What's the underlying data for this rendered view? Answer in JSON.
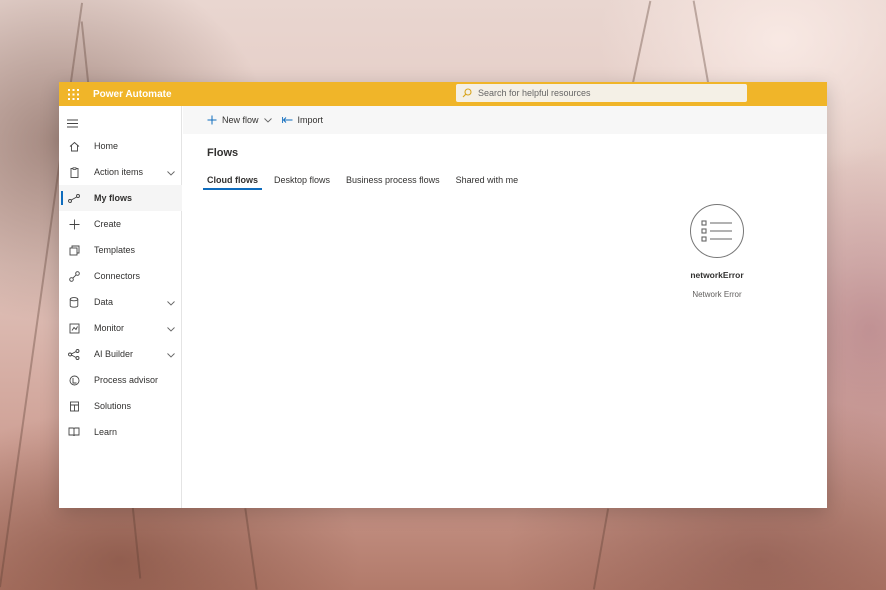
{
  "app": {
    "title": "Power Automate"
  },
  "search": {
    "placeholder": "Search for helpful resources"
  },
  "sidebar": {
    "items": [
      {
        "label": "Home",
        "icon": "home-icon",
        "has_chevron": false,
        "active": false
      },
      {
        "label": "Action items",
        "icon": "clipboard-icon",
        "has_chevron": true,
        "active": false
      },
      {
        "label": "My flows",
        "icon": "flow-icon",
        "has_chevron": false,
        "active": true
      },
      {
        "label": "Create",
        "icon": "plus-icon",
        "has_chevron": false,
        "active": false
      },
      {
        "label": "Templates",
        "icon": "templates-icon",
        "has_chevron": false,
        "active": false
      },
      {
        "label": "Connectors",
        "icon": "connector-icon",
        "has_chevron": false,
        "active": false
      },
      {
        "label": "Data",
        "icon": "database-icon",
        "has_chevron": true,
        "active": false
      },
      {
        "label": "Monitor",
        "icon": "monitor-icon",
        "has_chevron": true,
        "active": false
      },
      {
        "label": "AI Builder",
        "icon": "ai-builder-icon",
        "has_chevron": true,
        "active": false
      },
      {
        "label": "Process advisor",
        "icon": "process-advisor-icon",
        "has_chevron": false,
        "active": false
      },
      {
        "label": "Solutions",
        "icon": "solutions-icon",
        "has_chevron": false,
        "active": false
      },
      {
        "label": "Learn",
        "icon": "book-icon",
        "has_chevron": false,
        "active": false
      }
    ]
  },
  "commandbar": {
    "new_flow_label": "New flow",
    "import_label": "Import"
  },
  "main": {
    "title": "Flows",
    "tabs": [
      {
        "label": "Cloud flows",
        "active": true
      },
      {
        "label": "Desktop flows",
        "active": false
      },
      {
        "label": "Business process flows",
        "active": false
      },
      {
        "label": "Shared with me",
        "active": false
      }
    ],
    "error": {
      "title": "networkError",
      "message": "Network Error"
    }
  },
  "colors": {
    "accent": "#0f6cbd",
    "topbar": "#f0b529"
  }
}
